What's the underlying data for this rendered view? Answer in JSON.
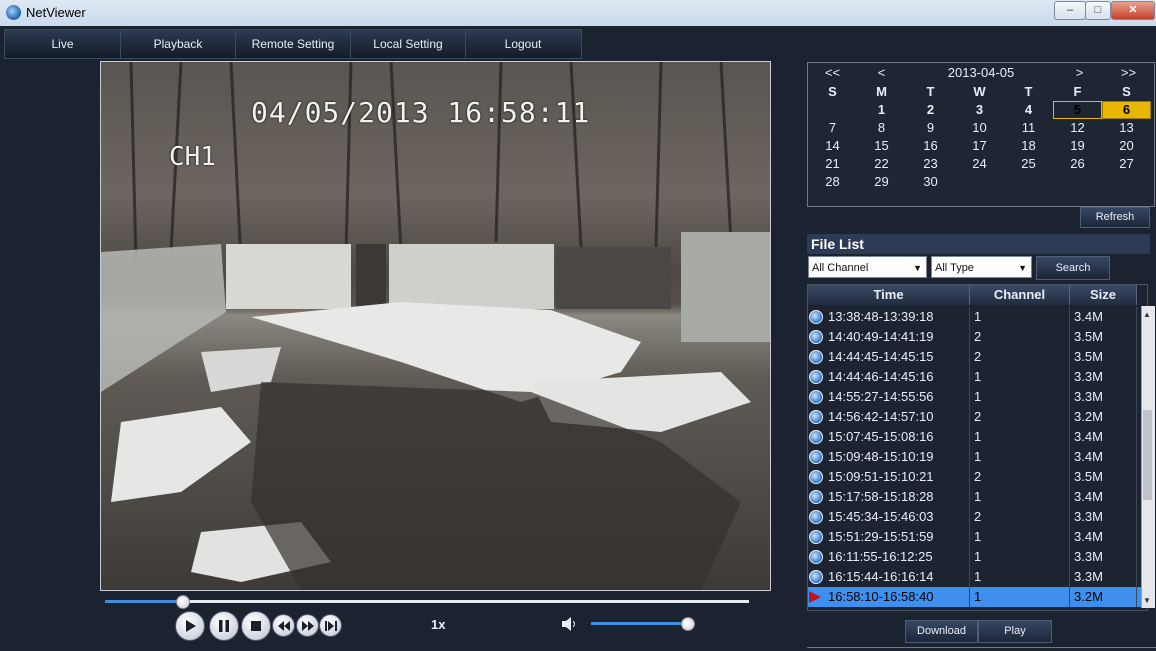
{
  "window": {
    "title": "NetViewer",
    "min": "–",
    "max": "□",
    "close": "✕"
  },
  "nav": [
    "Live",
    "Playback",
    "Remote Setting",
    "Local Setting",
    "Logout"
  ],
  "video": {
    "timestamp": "04/05/2013 16:58:11",
    "channel": "CH1"
  },
  "playback": {
    "progress": 0.12,
    "speed": "1x",
    "volume": 0.96
  },
  "calendar": {
    "prev_year": "<<",
    "prev_month": "<",
    "month": "2013-04-05",
    "next_month": ">",
    "next_year": ">>",
    "weekdays": [
      "S",
      "M",
      "T",
      "W",
      "T",
      "F",
      "S"
    ],
    "weeks": [
      [
        "",
        "1",
        "2",
        "3",
        "4",
        "5",
        "6"
      ],
      [
        "7",
        "8",
        "9",
        "10",
        "11",
        "12",
        "13"
      ],
      [
        "14",
        "15",
        "16",
        "17",
        "18",
        "19",
        "20"
      ],
      [
        "21",
        "22",
        "23",
        "24",
        "25",
        "26",
        "27"
      ],
      [
        "28",
        "29",
        "30",
        "",
        "",
        "",
        ""
      ]
    ],
    "refresh": "Refresh"
  },
  "file_list": {
    "title": "File List",
    "channel_filter": "All Channel",
    "type_filter": "All Type",
    "search": "Search",
    "columns": [
      "Time",
      "Channel",
      "Size"
    ],
    "rows": [
      [
        "13:38:48-13:39:18",
        "1",
        "3.4M"
      ],
      [
        "14:40:49-14:41:19",
        "2",
        "3.5M"
      ],
      [
        "14:44:45-14:45:15",
        "2",
        "3.5M"
      ],
      [
        "14:44:46-14:45:16",
        "1",
        "3.3M"
      ],
      [
        "14:55:27-14:55:56",
        "1",
        "3.3M"
      ],
      [
        "14:56:42-14:57:10",
        "2",
        "3.2M"
      ],
      [
        "15:07:45-15:08:16",
        "1",
        "3.4M"
      ],
      [
        "15:09:48-15:10:19",
        "1",
        "3.4M"
      ],
      [
        "15:09:51-15:10:21",
        "2",
        "3.5M"
      ],
      [
        "15:17:58-15:18:28",
        "1",
        "3.4M"
      ],
      [
        "15:45:34-15:46:03",
        "2",
        "3.3M"
      ],
      [
        "15:51:29-15:51:59",
        "1",
        "3.4M"
      ],
      [
        "16:11:55-16:12:25",
        "1",
        "3.3M"
      ],
      [
        "16:15:44-16:16:14",
        "1",
        "3.3M"
      ],
      [
        "16:58:10-16:58:40",
        "1",
        "3.2M"
      ]
    ],
    "download": "Download",
    "play": "Play"
  },
  "colors": {
    "accent": "#3f8fef",
    "highlight": "#e8b600",
    "marker": "#c0141e"
  }
}
